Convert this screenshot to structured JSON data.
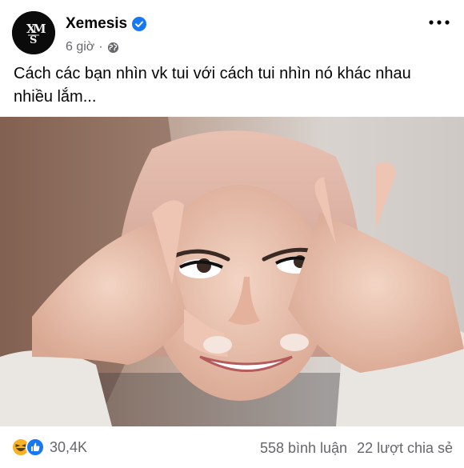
{
  "post": {
    "author": "Xemesis",
    "time": "6 giờ",
    "dot": "·",
    "caption": "Cách các bạn nhìn vk tui với cách tui nhìn nó khác nhau nhiều lắm...",
    "avatar_logo_text": "XEMESIS"
  },
  "icons": {
    "verified": "verified-badge-icon",
    "privacy": "globe-icon",
    "more": "more-options-icon",
    "reaction_haha": "haha-reaction-icon",
    "reaction_like": "like-reaction-icon"
  },
  "colors": {
    "brand_blue": "#1877f2",
    "secondary_text": "#65676b",
    "haha_yellow": "#f7b125"
  },
  "footer": {
    "reaction_count": "30,4K",
    "comments": "558 bình luận",
    "shares": "22 lượt chia sẻ"
  }
}
